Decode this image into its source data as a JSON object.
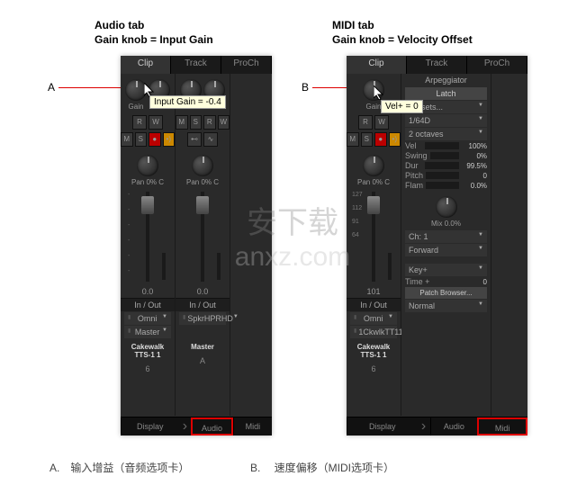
{
  "headings": {
    "left_title": "Audio tab",
    "left_sub": "Gain knob = Input Gain",
    "right_title": "MIDI tab",
    "right_sub": "Gain knob = Velocity Offset"
  },
  "labels": {
    "a": "A",
    "b": "B"
  },
  "tooltips": {
    "audio": "Input Gain = -0.4",
    "midi": "Vel+ = 0"
  },
  "common": {
    "tabs": {
      "clip": "Clip",
      "track": "Track",
      "proch": "ProCh"
    },
    "knobs": {
      "gain": "Gain",
      "pan": "Pan",
      "c": "C",
      "a": "A"
    },
    "buttons": {
      "m": "M",
      "s": "S",
      "r": "R",
      "w": "W"
    },
    "pan_value": "0% C",
    "inout": "In / Out",
    "dropdowns": {
      "omni": "Omni",
      "master": "Master",
      "spkr": "SpkrHPRHD",
      "ckwk": "1CkwlkTT11"
    },
    "tracks": {
      "cakewalk": "Cakewalk TTS-1 1",
      "master": "Master"
    },
    "nums": {
      "six": "6",
      "a": "A",
      "onezeroone": "101"
    },
    "fader_val": "0.0",
    "footer": {
      "display": "Display",
      "audio": "Audio",
      "midi": "Midi"
    }
  },
  "midi_scale": {
    "t1": "127",
    "t2": "112",
    "t3": "91",
    "t4": "64"
  },
  "arp": {
    "title": "Arpeggiator",
    "latch": "Latch",
    "presets": "Presets...",
    "rate": "1/64D",
    "octaves": "2 octaves",
    "vel": "Vel",
    "vel_v": "100%",
    "swing": "Swing",
    "swing_v": "0%",
    "dur": "Dur",
    "dur_v": "99.5%",
    "pitch": "Pitch",
    "pitch_v": "0",
    "flam": "Flam",
    "flam_v": "0.0%",
    "mix": "Mix  0.0%",
    "ch": "Ch: 1",
    "forward": "Forward",
    "key": "Key+",
    "time": "Time +",
    "time_v": "0",
    "patch": "Patch Browser...",
    "normal": "Normal"
  },
  "footnotes": {
    "a": "A.　输入增益（音频选项卡）",
    "b": "B.　 速度偏移（MIDI选项卡）"
  },
  "watermark": {
    "cn": "安下载",
    "en": "anxz.com"
  }
}
